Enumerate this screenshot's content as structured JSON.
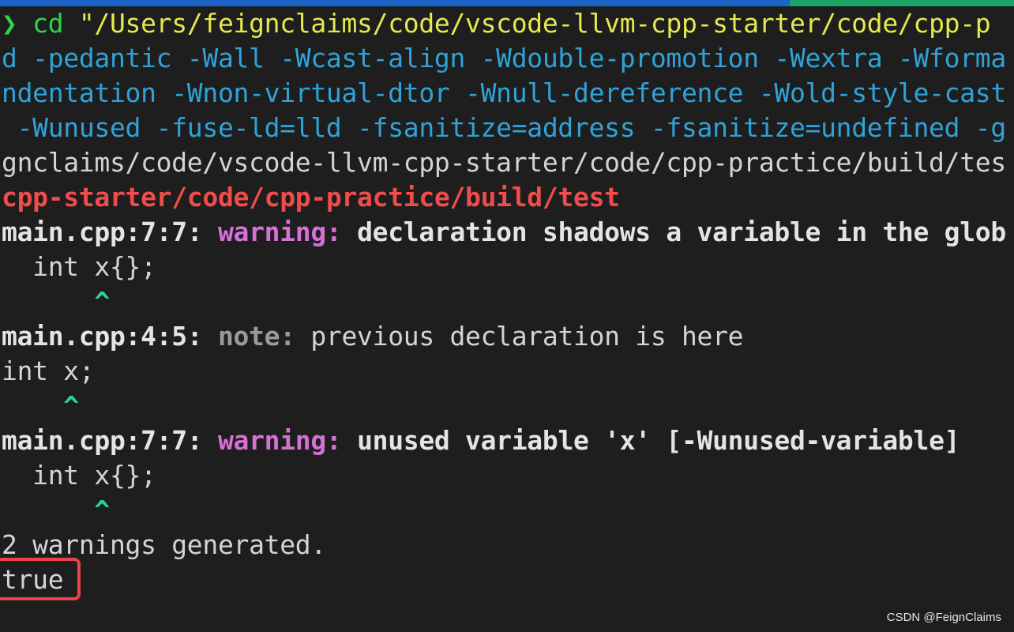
{
  "terminal": {
    "lines": [
      {
        "segments": [
          {
            "text": "❯ ",
            "style": "prompt"
          },
          {
            "text": "cd ",
            "style": "prompt"
          },
          {
            "text": "\"/Users/feignclaims/code/vscode-llvm-cpp-starter/code/cpp-p",
            "style": "yellow"
          }
        ]
      },
      {
        "segments": [
          {
            "text": "d -pedantic -Wall -Wcast-align -Wdouble-promotion -Wextra -Wforma",
            "style": "blue"
          }
        ]
      },
      {
        "segments": [
          {
            "text": "ndentation -Wnon-virtual-dtor -Wnull-dereference -Wold-style-cast",
            "style": "blue"
          }
        ]
      },
      {
        "segments": [
          {
            "text": " -Wunused -fuse-ld=lld -fsanitize=address -fsanitize=undefined -g",
            "style": "blue"
          }
        ]
      },
      {
        "segments": [
          {
            "text": "gnclaims/code/vscode-llvm-cpp-starter/code/cpp-practice/build/tes",
            "style": "plain"
          }
        ]
      },
      {
        "segments": [
          {
            "text": "cpp-starter/code/cpp-practice/build/test",
            "style": "red"
          }
        ]
      },
      {
        "segments": [
          {
            "text": "main.cpp:7:7: ",
            "style": "white-bold"
          },
          {
            "text": "warning: ",
            "style": "magenta"
          },
          {
            "text": "declaration shadows a variable in the glob",
            "style": "white-bold"
          }
        ]
      },
      {
        "segments": [
          {
            "text": "  int x{};",
            "style": "plain"
          }
        ]
      },
      {
        "segments": [
          {
            "text": "      ^",
            "style": "caret"
          }
        ]
      },
      {
        "segments": [
          {
            "text": "main.cpp:4:5: ",
            "style": "white-bold"
          },
          {
            "text": "note: ",
            "style": "grey"
          },
          {
            "text": "previous declaration is here",
            "style": "plain"
          }
        ]
      },
      {
        "segments": [
          {
            "text": "int x;",
            "style": "plain"
          }
        ]
      },
      {
        "segments": [
          {
            "text": "    ^",
            "style": "caret"
          }
        ]
      },
      {
        "segments": [
          {
            "text": "main.cpp:7:7: ",
            "style": "white-bold"
          },
          {
            "text": "warning: ",
            "style": "magenta"
          },
          {
            "text": "unused variable 'x' [-Wunused-variable]",
            "style": "white-bold"
          }
        ]
      },
      {
        "segments": [
          {
            "text": "  int x{};",
            "style": "plain"
          }
        ]
      },
      {
        "segments": [
          {
            "text": "      ^",
            "style": "caret"
          }
        ]
      },
      {
        "segments": [
          {
            "text": "2 warnings generated.",
            "style": "plain"
          }
        ]
      },
      {
        "segments": [
          {
            "text": "true",
            "style": "plain"
          }
        ]
      }
    ]
  },
  "watermark": "CSDN @FeignClaims",
  "colors": {
    "background": "#1e1e1e",
    "prompt": "#2cd64a",
    "path": "#e6e84d",
    "flags": "#2fa3d9",
    "error_path": "#f14c4c",
    "warning": "#d670d6",
    "caret": "#2ed09b",
    "highlight_box": "#e8434a"
  }
}
